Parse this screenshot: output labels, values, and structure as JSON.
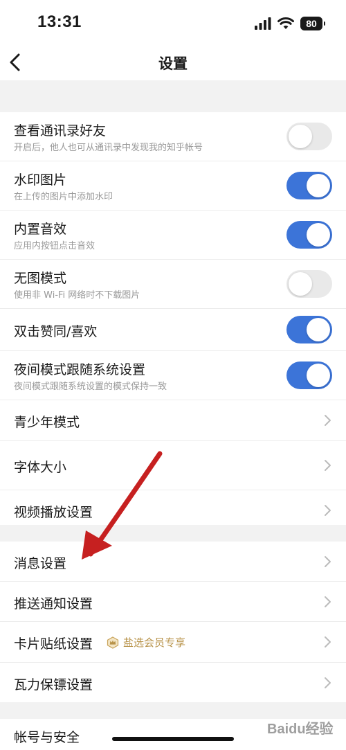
{
  "status_bar": {
    "time": "13:31",
    "battery": "80"
  },
  "header": {
    "title": "设置"
  },
  "settings_group_1": [
    {
      "title": "查看通讯录好友",
      "subtitle": "开启后，他人也可从通讯录中发现我的知乎帐号",
      "toggle": "off"
    },
    {
      "title": "水印图片",
      "subtitle": "在上传的图片中添加水印",
      "toggle": "on"
    },
    {
      "title": "内置音效",
      "subtitle": "应用内按钮点击音效",
      "toggle": "on"
    },
    {
      "title": "无图模式",
      "subtitle": "使用非 Wi-Fi 网络时不下载图片",
      "toggle": "off"
    },
    {
      "title": "双击赞同/喜欢",
      "toggle": "on"
    },
    {
      "title": "夜间模式跟随系统设置",
      "subtitle": "夜间模式跟随系统设置的模式保持一致",
      "toggle": "on"
    },
    {
      "title": "青少年模式"
    },
    {
      "title": "字体大小"
    },
    {
      "title": "视频播放设置"
    }
  ],
  "settings_group_2": [
    {
      "title": "消息设置"
    },
    {
      "title": "推送通知设置"
    },
    {
      "title": "卡片贴纸设置",
      "badge": "盐选会员专享"
    },
    {
      "title": "瓦力保镖设置"
    }
  ],
  "settings_group_3": [
    {
      "title": "帐号与安全"
    }
  ],
  "watermark": "Baidu经验",
  "colors": {
    "toggle_on": "#3c74d8",
    "toggle_off": "#e9e9e9",
    "badge": "#b8934a",
    "annotation_arrow": "#c62020"
  }
}
